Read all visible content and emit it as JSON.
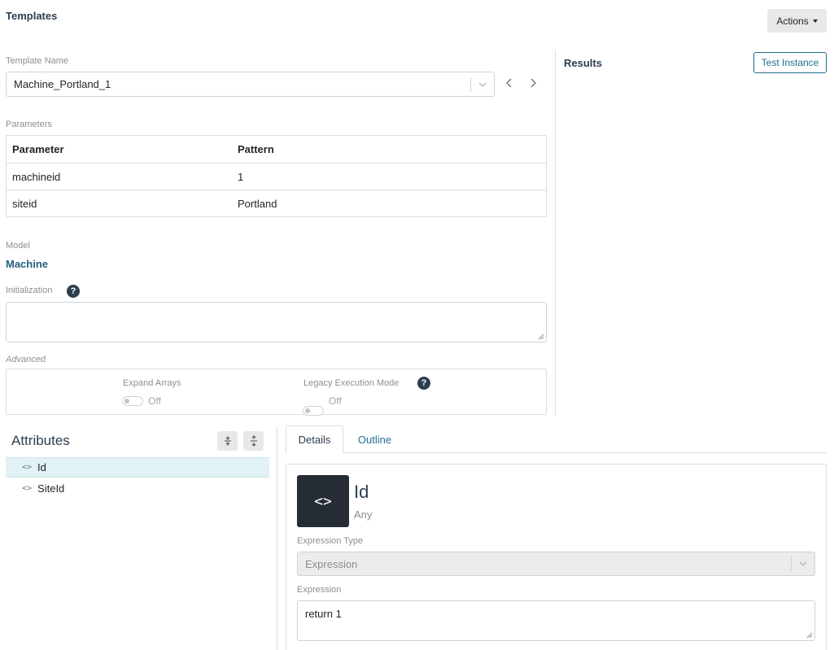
{
  "header": {
    "title": "Templates",
    "actions_label": "Actions"
  },
  "template": {
    "name_label": "Template Name",
    "name_value": "Machine_Portland_1"
  },
  "parameters": {
    "label": "Parameters",
    "columns": [
      "Parameter",
      "Pattern"
    ],
    "rows": [
      [
        "machineid",
        "1"
      ],
      [
        "siteid",
        "Portland"
      ]
    ]
  },
  "results": {
    "title": "Results",
    "test_button": "Test Instance"
  },
  "model": {
    "label": "Model",
    "value": "Machine"
  },
  "initialization": {
    "label": "Initialization",
    "value": ""
  },
  "advanced": {
    "label": "Advanced",
    "expand_arrays_label": "Expand Arrays",
    "expand_arrays_state": "Off",
    "legacy_mode_label": "Legacy Execution Mode",
    "legacy_mode_state": "Off"
  },
  "attributes": {
    "title": "Attributes",
    "items": [
      {
        "name": "Id",
        "selected": true
      },
      {
        "name": "SiteId",
        "selected": false
      }
    ]
  },
  "tabs": [
    {
      "label": "Details",
      "active": true
    },
    {
      "label": "Outline",
      "active": false
    }
  ],
  "details": {
    "name": "Id",
    "type": "Any",
    "expression_type_label": "Expression Type",
    "expression_type_value": "Expression",
    "expression_label": "Expression",
    "expression_value": "return 1"
  }
}
